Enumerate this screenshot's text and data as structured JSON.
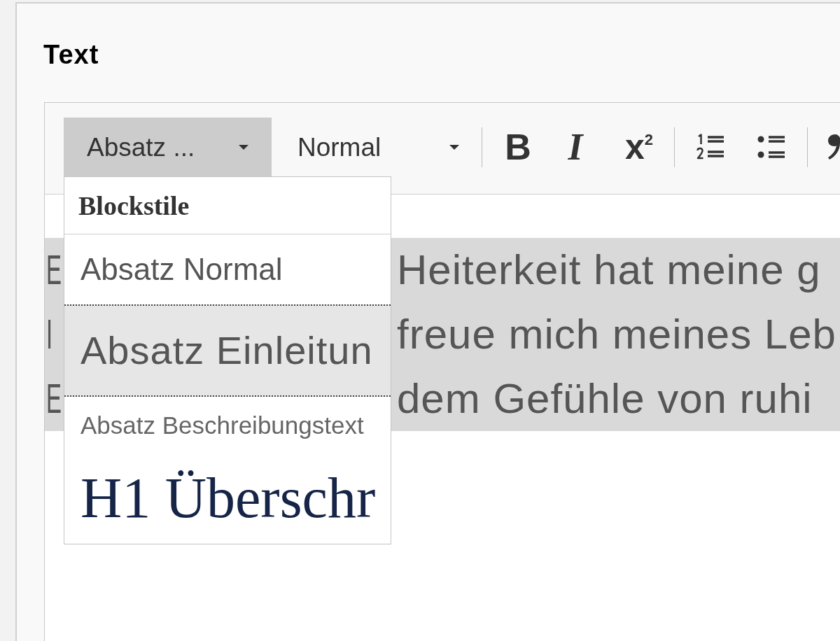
{
  "field": {
    "label": "Text"
  },
  "editor": {
    "toolbar": [
      {
        "kind": "combo",
        "label": "Absatz ...",
        "expanded": true
      },
      {
        "kind": "combo",
        "label": "Normal",
        "expanded": false
      },
      {
        "kind": "separator"
      },
      {
        "kind": "bold",
        "label": "B"
      },
      {
        "kind": "italic",
        "label": "I"
      },
      {
        "kind": "superscript",
        "label": "x$^{2}$"
      },
      {
        "kind": "separator"
      },
      {
        "kind": "numbered-list"
      },
      {
        "kind": "bulleted-list"
      },
      {
        "kind": "separator"
      },
      {
        "kind": "quote"
      }
    ],
    "format_menu": {
      "title": "Blockstile",
      "items": [
        {
          "kind": "paragraph-normal",
          "label": "Absatz Normal",
          "selected": false
        },
        {
          "kind": "paragraph-intro",
          "label": "Absatz Einleitun",
          "selected": true
        },
        {
          "kind": "paragraph-description",
          "label": "Absatz Beschreibungstext",
          "selected": false
        },
        {
          "kind": "heading-1",
          "label": "H1 Überschr",
          "selected": false
        }
      ]
    },
    "content": {
      "selected": true,
      "lines": [
        {
          "left": "E",
          "right": "Heiterkeit hat meine g"
        },
        {
          "left": "I",
          "right": "freue mich meines Leb"
        },
        {
          "left": "E",
          "right": "dem Gefühle von ruhi"
        }
      ]
    }
  }
}
